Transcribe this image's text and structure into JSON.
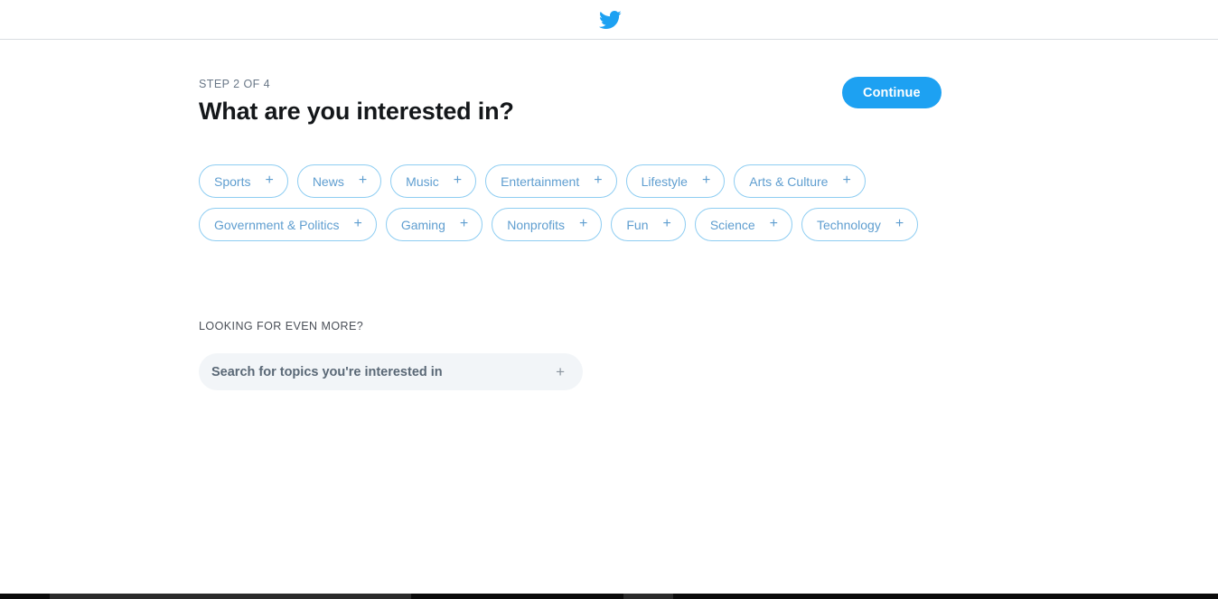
{
  "header": {
    "logo_icon": "twitter-bird-icon",
    "brand_color": "#1da1f2"
  },
  "main": {
    "step_label": "STEP 2 OF 4",
    "title": "What are you interested in?",
    "continue_label": "Continue"
  },
  "topics": {
    "plus_icon": "+",
    "rows": [
      [
        {
          "label": "Sports"
        },
        {
          "label": "News"
        },
        {
          "label": "Music"
        },
        {
          "label": "Entertainment"
        },
        {
          "label": "Lifestyle"
        },
        {
          "label": "Arts & Culture"
        }
      ],
      [
        {
          "label": "Government & Politics"
        },
        {
          "label": "Gaming"
        },
        {
          "label": "Nonprofits"
        },
        {
          "label": "Fun"
        },
        {
          "label": "Science"
        },
        {
          "label": "Technology"
        }
      ]
    ]
  },
  "more": {
    "label": "LOOKING FOR EVEN MORE?",
    "search_placeholder": "Search for topics you're interested in",
    "search_value": "",
    "add_icon": "+"
  },
  "colors": {
    "accent": "#1da1f2",
    "chip_border": "#8ecdf2",
    "chip_text": "#5f9ed0",
    "title_text": "#14171a",
    "muted_text": "#697787",
    "search_bg": "#f2f5f8"
  }
}
